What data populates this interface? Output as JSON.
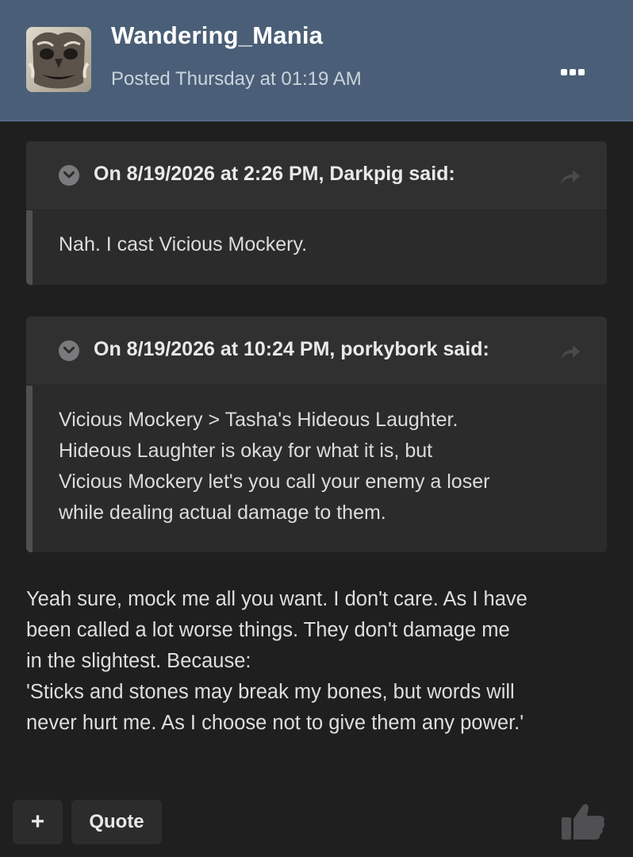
{
  "post": {
    "author": "Wandering_Mania",
    "posted": "Posted Thursday at 01:19 AM",
    "avatar_icon": "stone-face-avatar",
    "more_icon": "ellipsis-icon"
  },
  "quotes": [
    {
      "citation": "On 8/19/2026 at 2:26 PM, Darkpig said:",
      "lines": [
        "Nah. I cast Vicious Mockery."
      ]
    },
    {
      "citation": "On 8/19/2026 at 10:24 PM, porkybork said:",
      "lines": [
        "Vicious Mockery > Tasha's Hideous Laughter.",
        "Hideous Laughter is okay for what it is, but",
        "Vicious Mockery let's you call your enemy a loser",
        "while dealing actual damage to them."
      ]
    }
  ],
  "reply": {
    "lines": [
      "Yeah sure, mock me all you want. I don't care. As I have",
      "been called a lot worse things. They don't damage me",
      "in the slightest. Because:",
      "'Sticks and stones may break my bones, but words will",
      "never hurt me. As I choose not to give them any power.'"
    ]
  },
  "footer": {
    "plus_label": "+",
    "quote_label": "Quote",
    "like_icon": "thumbs-up-icon"
  },
  "colors": {
    "header_bg": "#4a5f77",
    "page_bg": "#1f1f20",
    "quote_bg": "#2b2b2c"
  }
}
